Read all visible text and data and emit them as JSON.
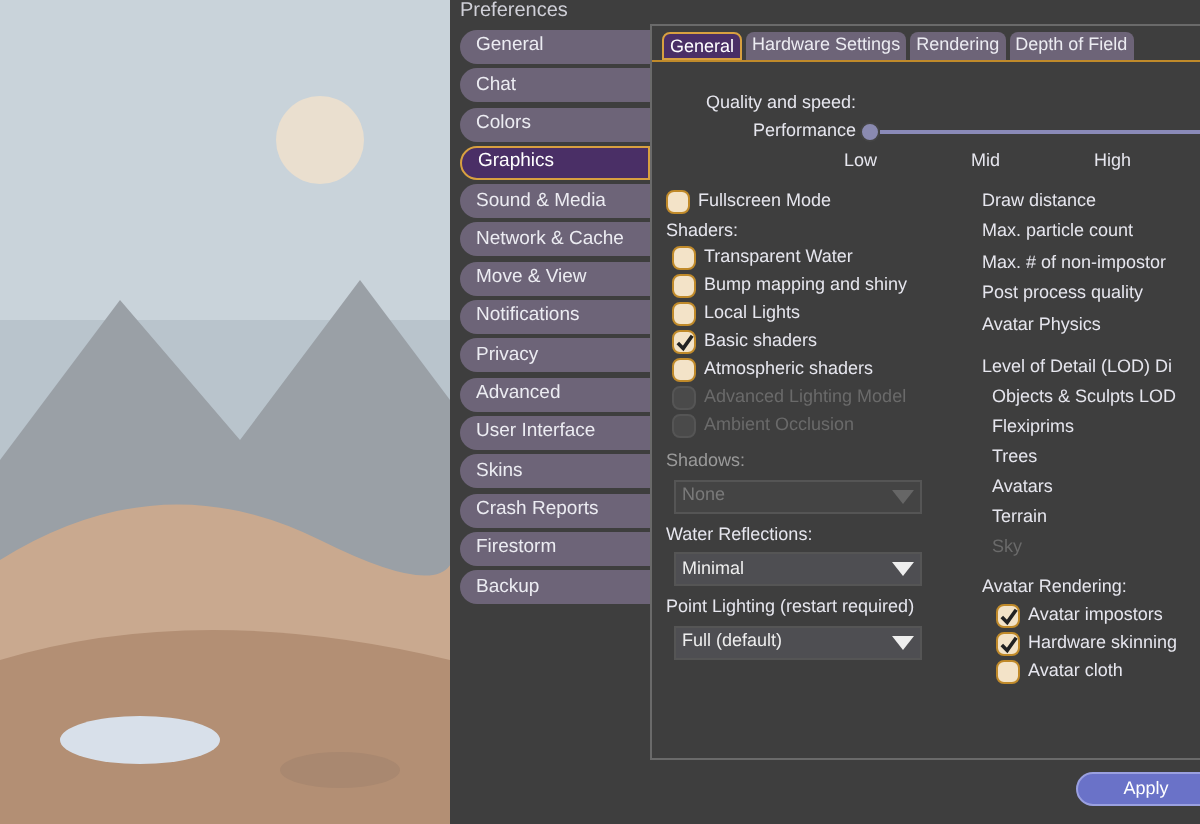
{
  "window": {
    "title": "Preferences"
  },
  "viewport": {
    "kind": "picture"
  },
  "sidebar": {
    "items": [
      {
        "label": "General",
        "selected": false
      },
      {
        "label": "Chat",
        "selected": false
      },
      {
        "label": "Colors",
        "selected": false
      },
      {
        "label": "Graphics",
        "selected": true
      },
      {
        "label": "Sound & Media",
        "selected": false
      },
      {
        "label": "Network & Cache",
        "selected": false
      },
      {
        "label": "Move & View",
        "selected": false
      },
      {
        "label": "Notifications",
        "selected": false
      },
      {
        "label": "Privacy",
        "selected": false
      },
      {
        "label": "Advanced",
        "selected": false
      },
      {
        "label": "User Interface",
        "selected": false
      },
      {
        "label": "Skins",
        "selected": false
      },
      {
        "label": "Crash Reports",
        "selected": false
      },
      {
        "label": "Firestorm",
        "selected": false
      },
      {
        "label": "Backup",
        "selected": false
      }
    ]
  },
  "tabs": [
    {
      "label": "General",
      "selected": true
    },
    {
      "label": "Hardware Settings",
      "selected": false
    },
    {
      "label": "Rendering",
      "selected": false
    },
    {
      "label": "Depth of Field",
      "selected": false
    }
  ],
  "quality": {
    "heading": "Quality and speed:",
    "label": "Performance",
    "level": 0,
    "ticks": [
      "Low",
      "Mid",
      "High"
    ]
  },
  "fullscreen": {
    "label": "Fullscreen Mode",
    "checked": false,
    "disabled": false
  },
  "shaders": {
    "heading": "Shaders:",
    "items": [
      {
        "label": "Transparent Water",
        "checked": false,
        "disabled": false
      },
      {
        "label": "Bump mapping and shiny",
        "checked": false,
        "disabled": false
      },
      {
        "label": "Local Lights",
        "checked": false,
        "disabled": false
      },
      {
        "label": "Basic shaders",
        "checked": true,
        "disabled": false
      },
      {
        "label": "Atmospheric shaders",
        "checked": false,
        "disabled": false
      },
      {
        "label": "Advanced Lighting Model",
        "checked": false,
        "disabled": true
      },
      {
        "label": "Ambient Occlusion",
        "checked": false,
        "disabled": true
      }
    ]
  },
  "dropdowns": [
    {
      "label": "Shadows:",
      "value": "None",
      "disabled": true
    },
    {
      "label": "Water Reflections:",
      "value": "Minimal",
      "disabled": false
    },
    {
      "label": "Point Lighting (restart required)",
      "value": "Full (default)",
      "disabled": false
    }
  ],
  "right_labels": [
    "Draw distance",
    "Max. particle count",
    "Max. # of non-impostor",
    "Post process quality",
    "Avatar Physics"
  ],
  "lod": {
    "heading": "Level of Detail (LOD) Di",
    "items": [
      {
        "label": "Objects & Sculpts LOD",
        "disabled": false
      },
      {
        "label": "Flexiprims",
        "disabled": false
      },
      {
        "label": "Trees",
        "disabled": false
      },
      {
        "label": "Avatars",
        "disabled": false
      },
      {
        "label": "Terrain",
        "disabled": false
      },
      {
        "label": "Sky",
        "disabled": true
      }
    ]
  },
  "avatar_rendering": {
    "heading": "Avatar Rendering:",
    "items": [
      {
        "label": "Avatar impostors",
        "checked": true,
        "disabled": false
      },
      {
        "label": "Hardware skinning",
        "checked": true,
        "disabled": false
      },
      {
        "label": "Avatar cloth",
        "checked": false,
        "disabled": false
      }
    ]
  },
  "buttons": [
    "Apply"
  ]
}
